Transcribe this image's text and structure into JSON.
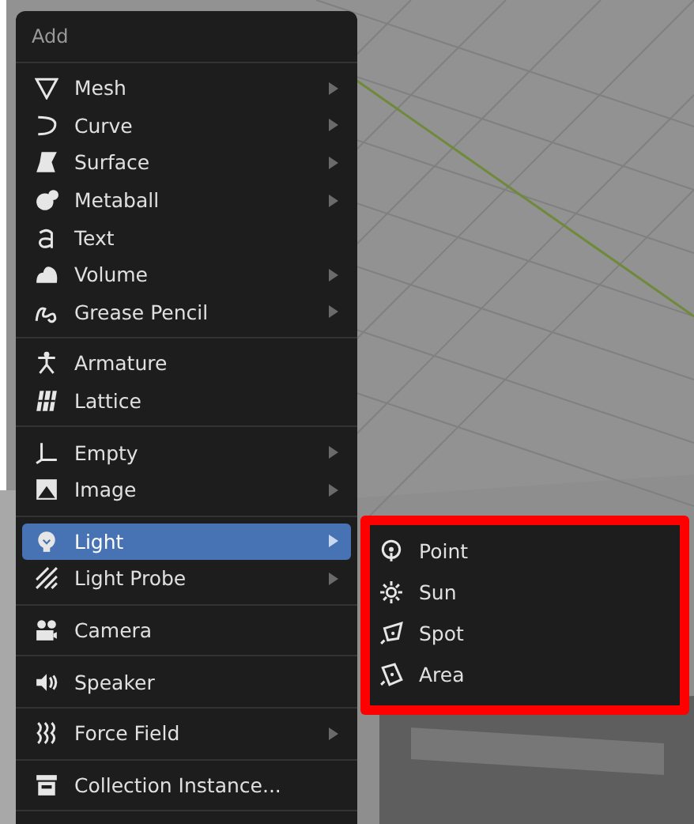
{
  "menu": {
    "title": "Add",
    "groups": [
      [
        {
          "label": "Mesh",
          "submenu": true,
          "selected": false
        },
        {
          "label": "Curve",
          "submenu": true,
          "selected": false
        },
        {
          "label": "Surface",
          "submenu": true,
          "selected": false
        },
        {
          "label": "Metaball",
          "submenu": true,
          "selected": false
        },
        {
          "label": "Text",
          "submenu": false,
          "selected": false
        },
        {
          "label": "Volume",
          "submenu": true,
          "selected": false
        },
        {
          "label": "Grease Pencil",
          "submenu": true,
          "selected": false
        }
      ],
      [
        {
          "label": "Armature",
          "submenu": false,
          "selected": false
        },
        {
          "label": "Lattice",
          "submenu": false,
          "selected": false
        }
      ],
      [
        {
          "label": "Empty",
          "submenu": true,
          "selected": false
        },
        {
          "label": "Image",
          "submenu": true,
          "selected": false
        }
      ],
      [
        {
          "label": "Light",
          "submenu": true,
          "selected": true
        },
        {
          "label": "Light Probe",
          "submenu": true,
          "selected": false
        }
      ],
      [
        {
          "label": "Camera",
          "submenu": false,
          "selected": false
        }
      ],
      [
        {
          "label": "Speaker",
          "submenu": false,
          "selected": false
        }
      ],
      [
        {
          "label": "Force Field",
          "submenu": true,
          "selected": false
        }
      ],
      [
        {
          "label": "Collection Instance...",
          "submenu": false,
          "selected": false
        }
      ]
    ]
  },
  "submenu": {
    "items": [
      {
        "label": "Point"
      },
      {
        "label": "Sun"
      },
      {
        "label": "Spot"
      },
      {
        "label": "Area"
      }
    ]
  }
}
